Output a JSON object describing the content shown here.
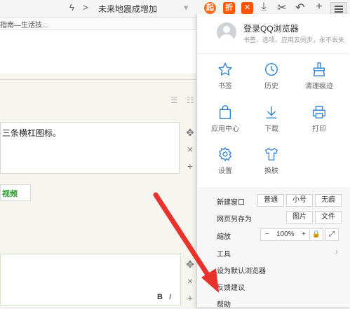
{
  "topbar": {
    "headline": "未来地震成增加",
    "lightning_icon": "lightning-icon",
    "separator_symbol": ">",
    "badge_a_text": "起",
    "badge_b_text": "折",
    "badge_a_color": "#ff6b1a",
    "badge_b_color": "#ff5a00",
    "badge_c_color": "#ff5500"
  },
  "tab": {
    "title": "指南—生活技..."
  },
  "page": {
    "editor_text": "三条横杠图标。",
    "video_button": "视频",
    "video_color": "#2f9d2f",
    "bold_label": "B",
    "italic_label": "I"
  },
  "menu": {
    "login_title": "登录QQ浏览器",
    "login_sub": "书签、选项、应用云同步，永不丢失",
    "grid": [
      {
        "label": "书签",
        "icon": "star-icon"
      },
      {
        "label": "历史",
        "icon": "clock-icon"
      },
      {
        "label": "清理痕迹",
        "icon": "broom-icon"
      },
      {
        "label": "应用中心",
        "icon": "bag-icon"
      },
      {
        "label": "下载",
        "icon": "download-icon"
      },
      {
        "label": "打印",
        "icon": "printer-icon"
      },
      {
        "label": "设置",
        "icon": "gear-icon"
      },
      {
        "label": "换肤",
        "icon": "shirt-icon"
      }
    ],
    "accent_color": "#2b7fd4",
    "new_window": {
      "label": "新建窗口",
      "options": [
        "普通",
        "小号",
        "无痕"
      ]
    },
    "save_as": {
      "label": "网页另存为",
      "options": [
        "图片",
        "文件"
      ]
    },
    "zoom": {
      "label": "缩放",
      "minus": "−",
      "value": "100%",
      "plus": "+"
    },
    "tools": "工具",
    "set_default": "设为默认浏览器",
    "feedback": "反馈建议",
    "help": "帮助"
  },
  "annotation": {
    "arrow_color": "#e8322b"
  }
}
